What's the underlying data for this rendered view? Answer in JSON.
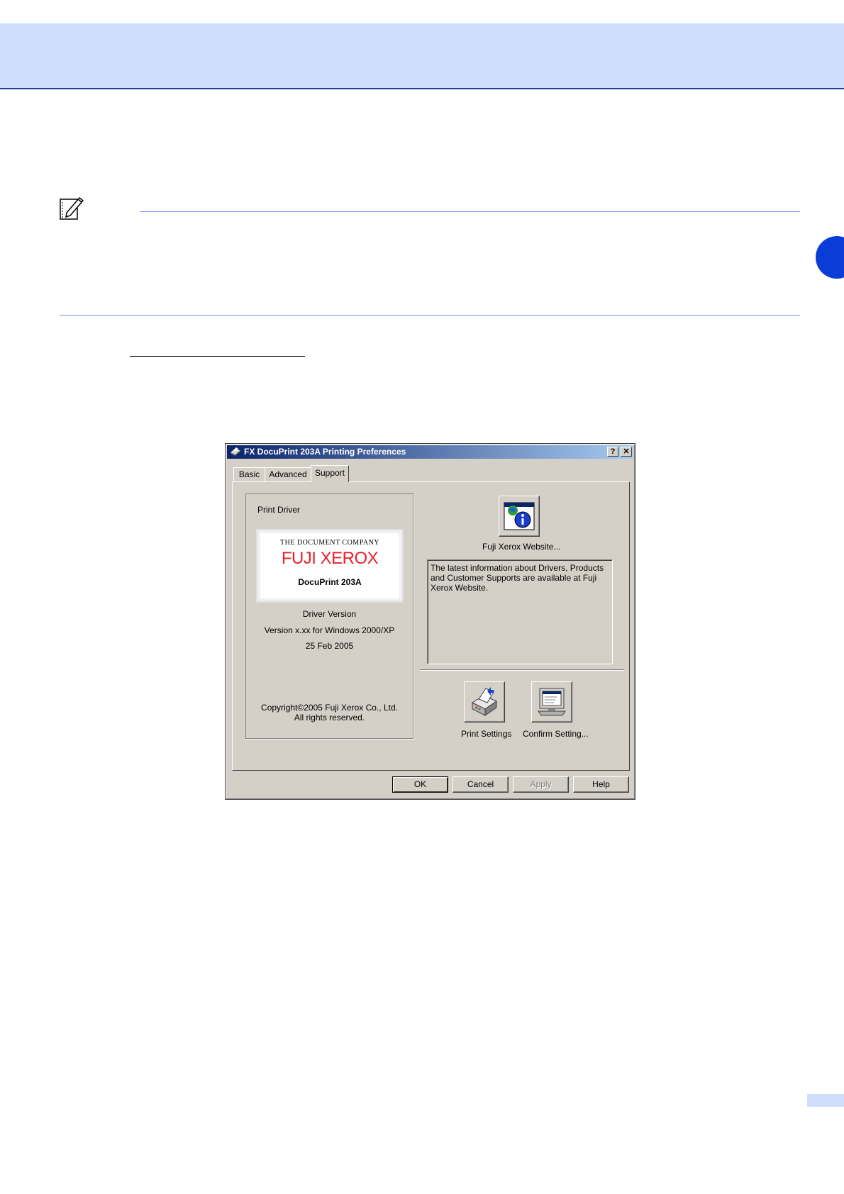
{
  "dialog": {
    "title": "FX DocuPrint 203A Printing Preferences",
    "help_glyph": "?",
    "close_glyph": "✕",
    "tabs": [
      {
        "label": "Basic"
      },
      {
        "label": "Advanced"
      },
      {
        "label": "Support"
      }
    ],
    "print_driver": {
      "group_title": "Print Driver",
      "logo": {
        "tagline": "THE DOCUMENT COMPANY",
        "brand": "FUJI XEROX",
        "model": "DocuPrint 203A"
      },
      "version_label": "Driver Version",
      "version_value": "Version x.xx for Windows 2000/XP",
      "date": "25 Feb 2005",
      "copyright_line1": "Copyright©2005 Fuji Xerox Co., Ltd.",
      "copyright_line2": "All rights reserved."
    },
    "website": {
      "caption": "Fuji Xerox Website...",
      "info_text": "The latest information about Drivers, Products and Customer Supports are available at Fuji Xerox Website."
    },
    "actions": {
      "print_settings": "Print Settings",
      "confirm_setting": "Confirm Setting..."
    },
    "buttons": {
      "ok": "OK",
      "cancel": "Cancel",
      "apply": "Apply",
      "help": "Help"
    }
  },
  "colors": {
    "header_band": "#cfdefc",
    "chapter_tab": "#0a3cd8",
    "brand_red": "#e8202a",
    "title_gradient_start": "#0a246a",
    "title_gradient_end": "#a6caf0"
  }
}
